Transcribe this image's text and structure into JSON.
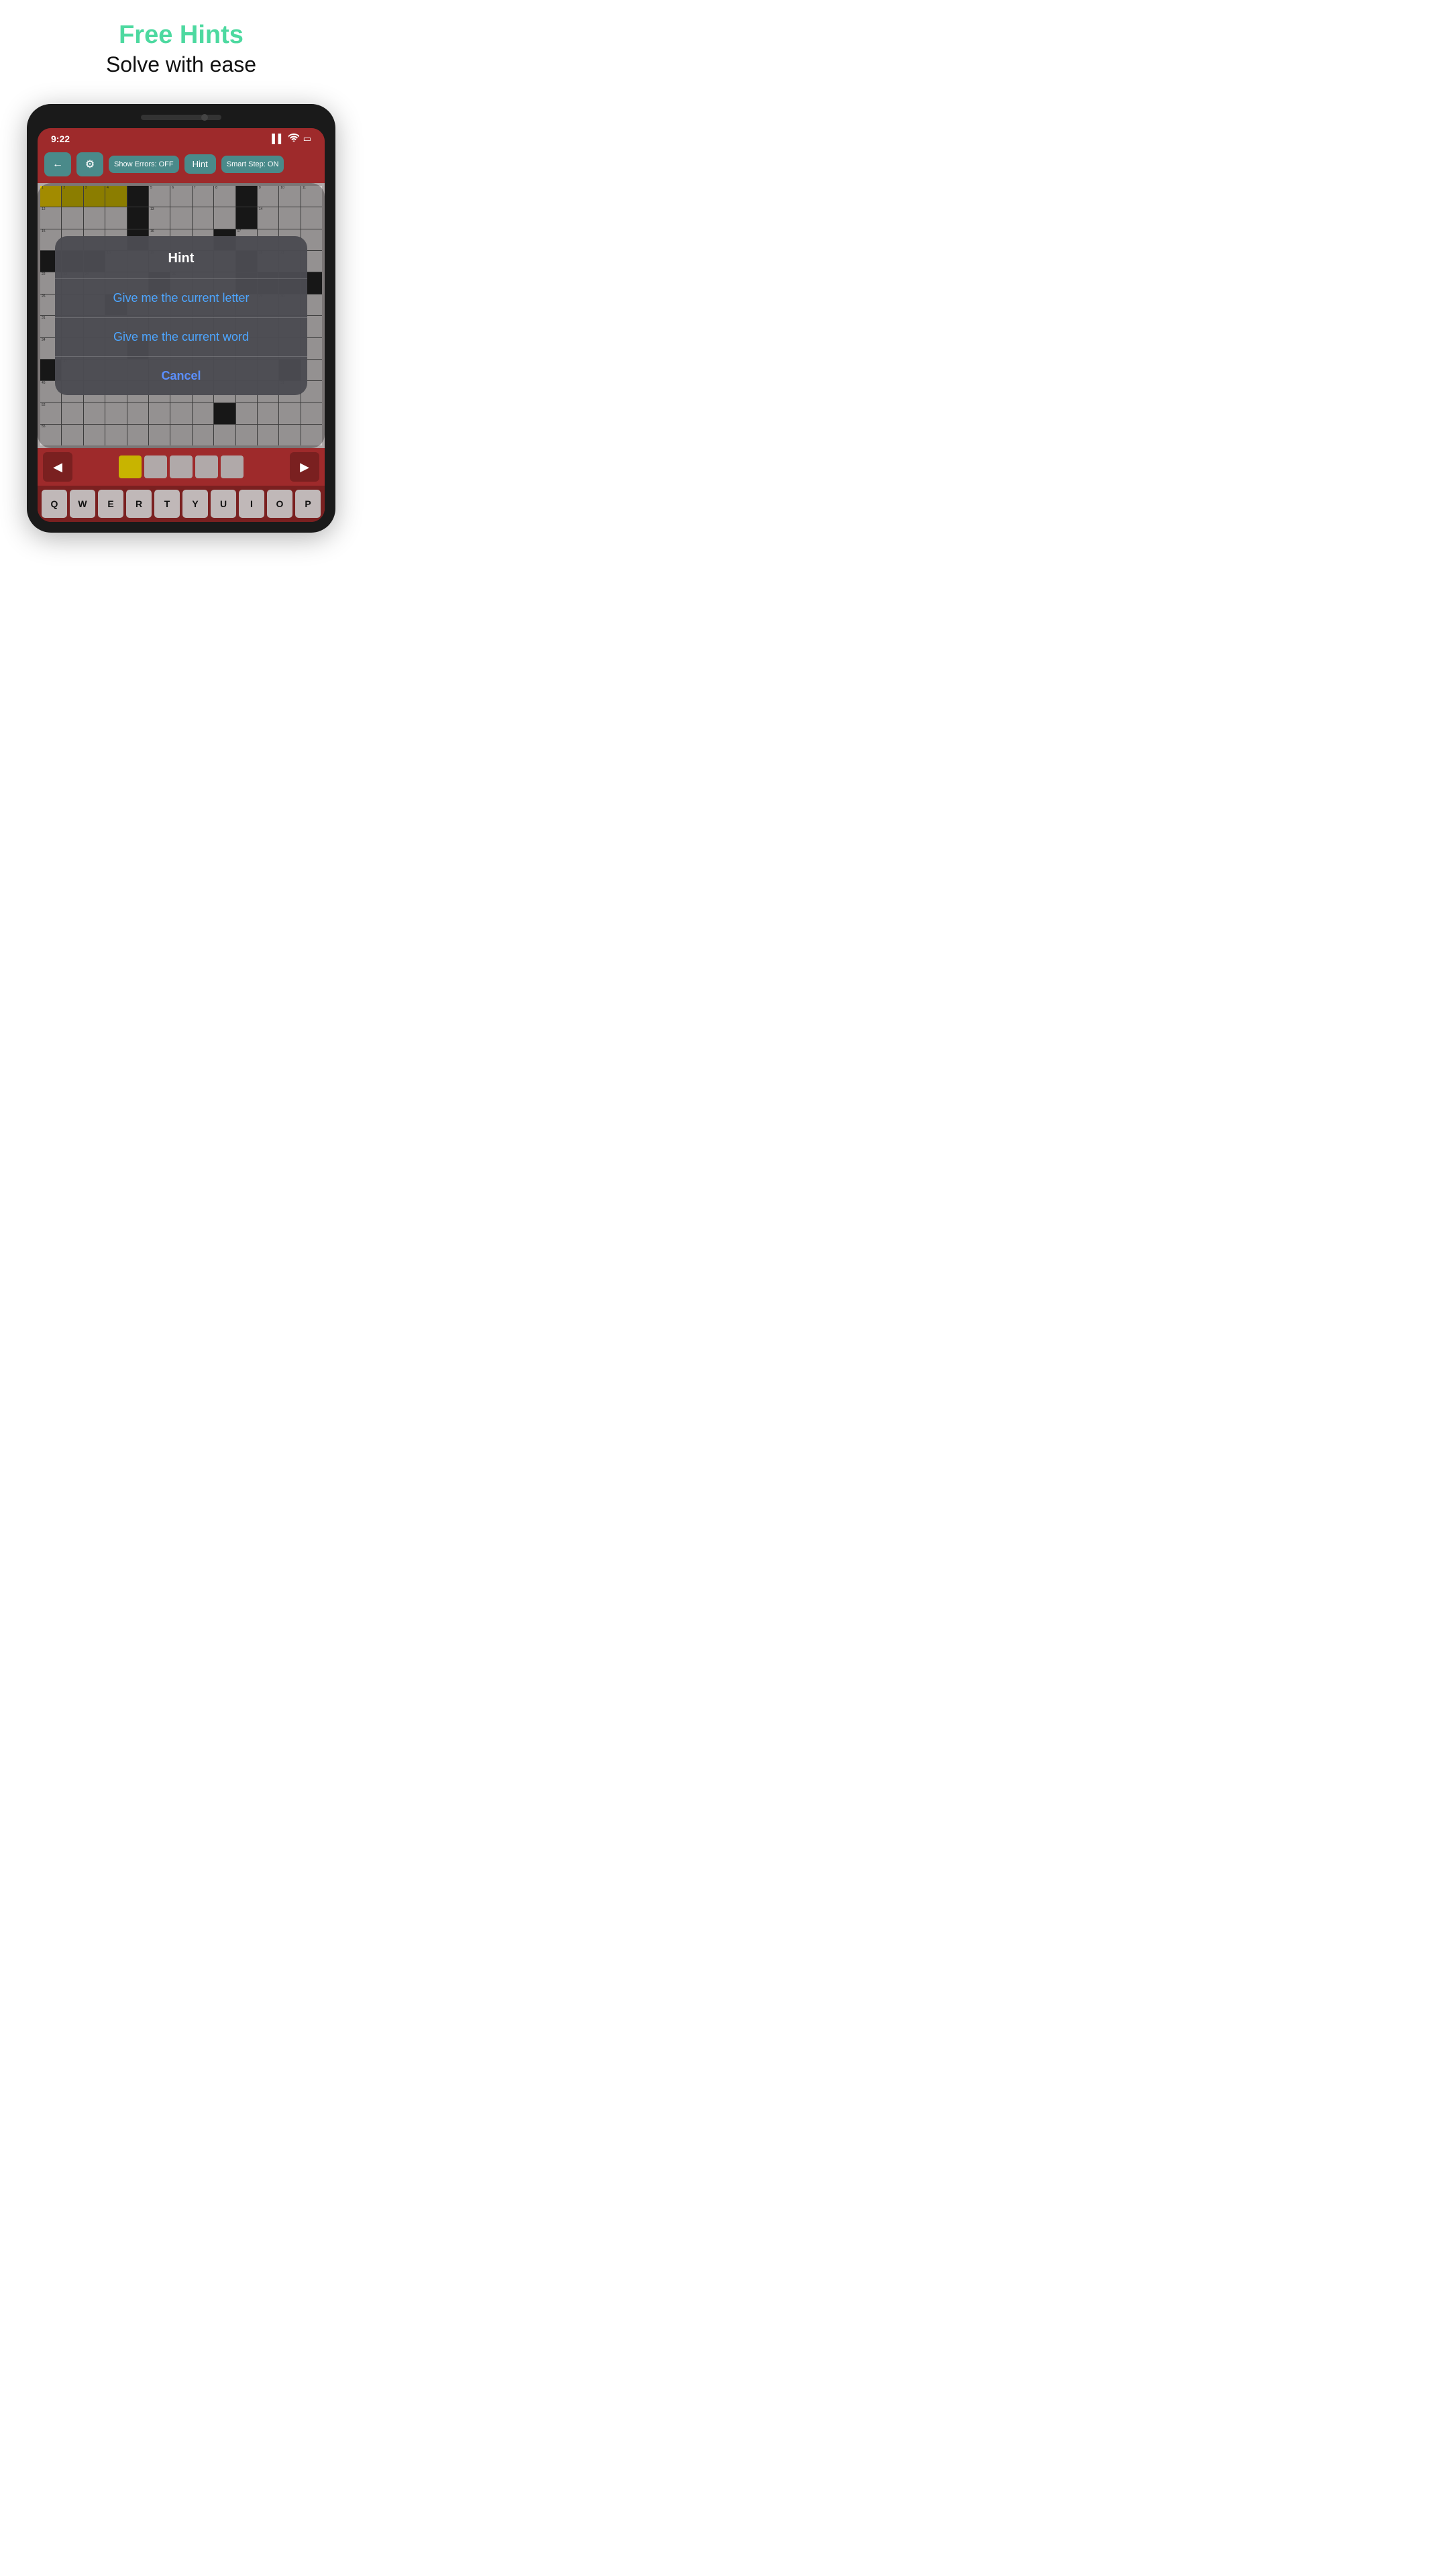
{
  "header": {
    "title": "Free Hints",
    "subtitle": "Solve with ease"
  },
  "status_bar": {
    "time": "9:22",
    "signal_icon": "▌▌",
    "wifi_icon": "wifi",
    "battery_icon": "▭"
  },
  "toolbar": {
    "back_label": "←",
    "settings_label": "⚙",
    "show_errors_label": "Show Errors: OFF",
    "hint_label": "Hint",
    "smart_step_label": "Smart Step: ON"
  },
  "hint_dialog": {
    "title": "Hint",
    "option1": "Give me the current letter",
    "option2": "Give me the current word",
    "cancel": "Cancel"
  },
  "keyboard": {
    "row1": [
      "Q",
      "W",
      "E",
      "R",
      "T",
      "Y",
      "U",
      "I",
      "O",
      "P"
    ]
  },
  "colors": {
    "accent_green": "#4dd9a0",
    "toolbar_bg": "#9e2a2b",
    "toolbar_btn": "#4a8a8a",
    "cell_highlight": "#c8b400",
    "hint_option_color": "#4da6ff"
  }
}
